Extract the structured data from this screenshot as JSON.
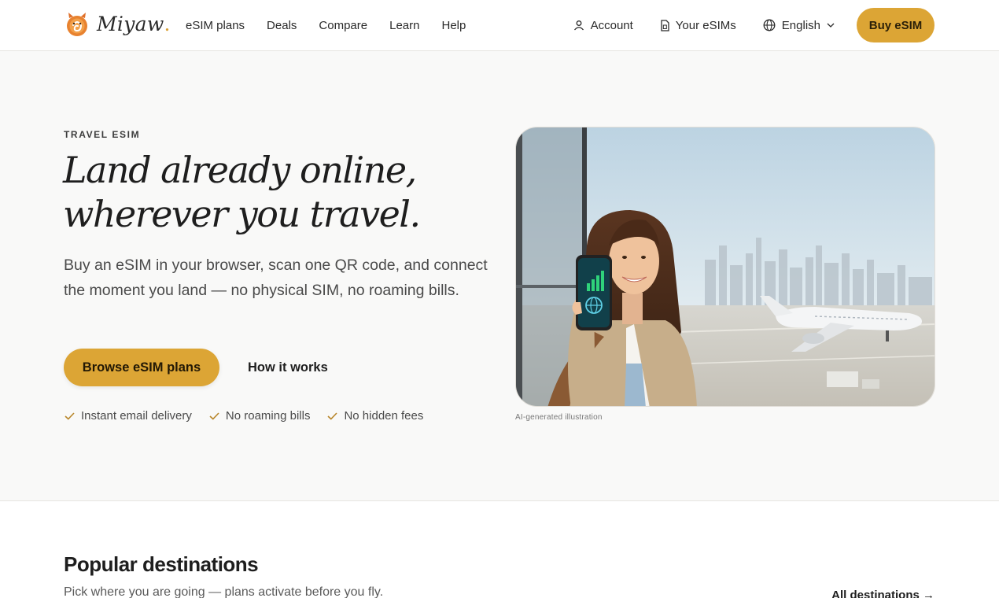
{
  "header": {
    "brand": "Miyaw",
    "brand_dot": ".",
    "nav": [
      "eSIM plans",
      "Deals",
      "Compare",
      "Learn",
      "Help"
    ],
    "account_label": "Account",
    "esims_label": "Your eSIMs",
    "language_label": "English",
    "buy_label": "Buy eSIM"
  },
  "hero": {
    "eyebrow": "TRAVEL ESIM",
    "headline_line1": "Land already online,",
    "headline_line2": "wherever you travel.",
    "lede": "Buy an eSIM in your browser, scan one QR code, and connect the moment you land — no physical SIM, no roaming bills.",
    "primary_cta": "Browse eSIM plans",
    "secondary_cta": "How it works",
    "checks": [
      "Instant email delivery",
      "No roaming bills",
      "No hidden fees"
    ],
    "image_caption": "AI-generated illustration"
  },
  "destinations": {
    "title": "Popular destinations",
    "subtitle": "Pick where you are going — plans activate before you fly.",
    "all_link": "All destinations →"
  },
  "colors": {
    "accent": "#dca535",
    "background": "#f9f9f8",
    "text": "#1e1e1e",
    "check": "#b8862a"
  }
}
